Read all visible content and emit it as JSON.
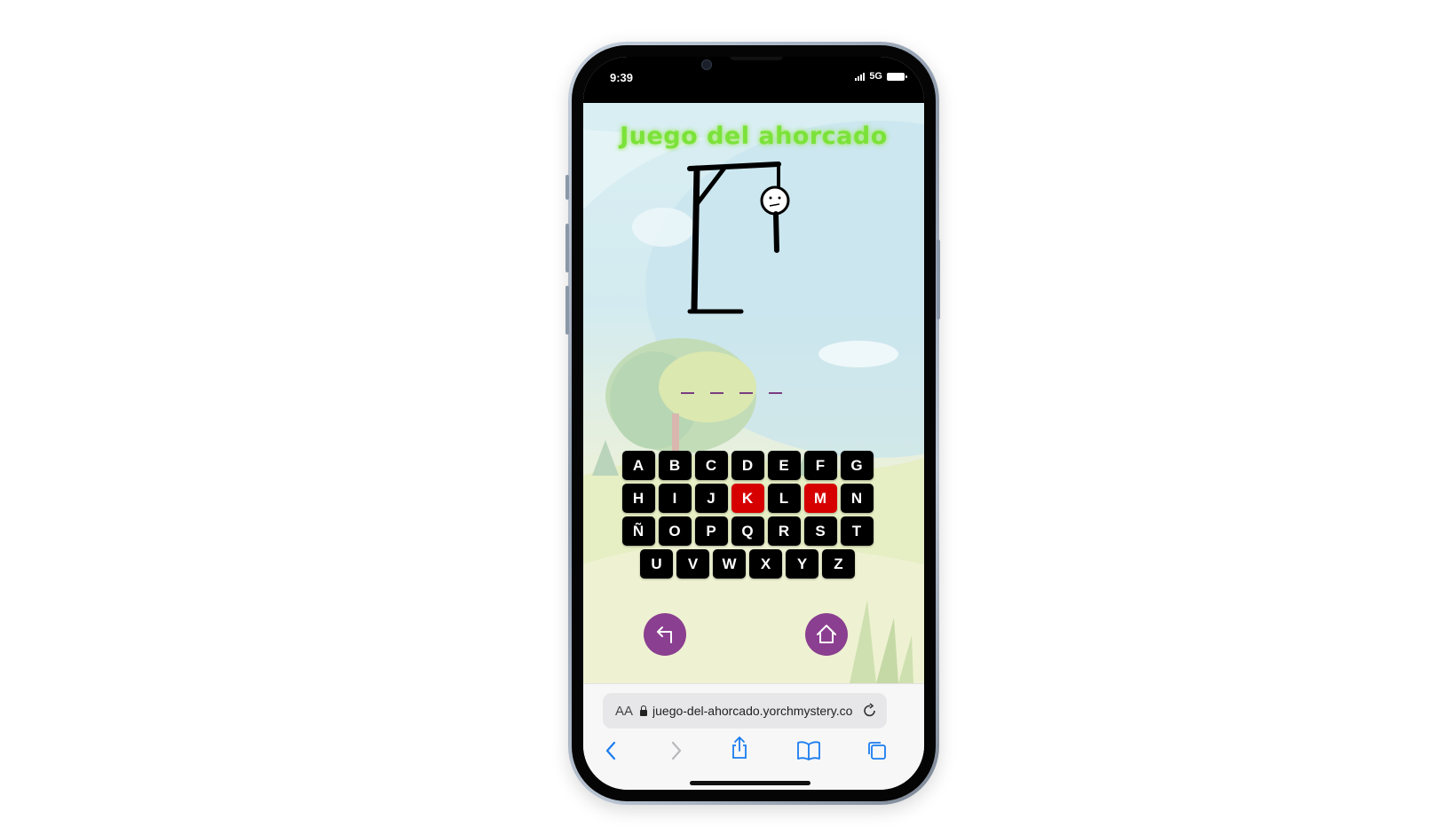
{
  "status": {
    "time": "9:39",
    "network": "5G"
  },
  "game": {
    "title": "Juego del ahorcado",
    "word_blanks": 4,
    "keyboard_rows": [
      [
        "A",
        "B",
        "C",
        "D",
        "E",
        "F",
        "G"
      ],
      [
        "H",
        "I",
        "J",
        "K",
        "L",
        "M",
        "N"
      ],
      [
        "Ñ",
        "O",
        "P",
        "Q",
        "R",
        "S",
        "T"
      ],
      [
        "U",
        "V",
        "W",
        "X",
        "Y",
        "Z"
      ]
    ],
    "used_letters": [
      "K",
      "M"
    ],
    "colors": {
      "title": "#7be23a",
      "key": "#000000",
      "used_key": "#d60000",
      "round_button": "#8b3f90",
      "blank": "#7a3c80"
    },
    "buttons": {
      "back_icon": "back-arrow-icon",
      "home_icon": "home-icon"
    }
  },
  "browser": {
    "aa_label": "AA",
    "url": "juego-del-ahorcado.yorchmystery.co",
    "toolbar_icons": [
      "back-icon",
      "forward-icon",
      "share-icon",
      "bookmarks-icon",
      "tabs-icon"
    ]
  }
}
